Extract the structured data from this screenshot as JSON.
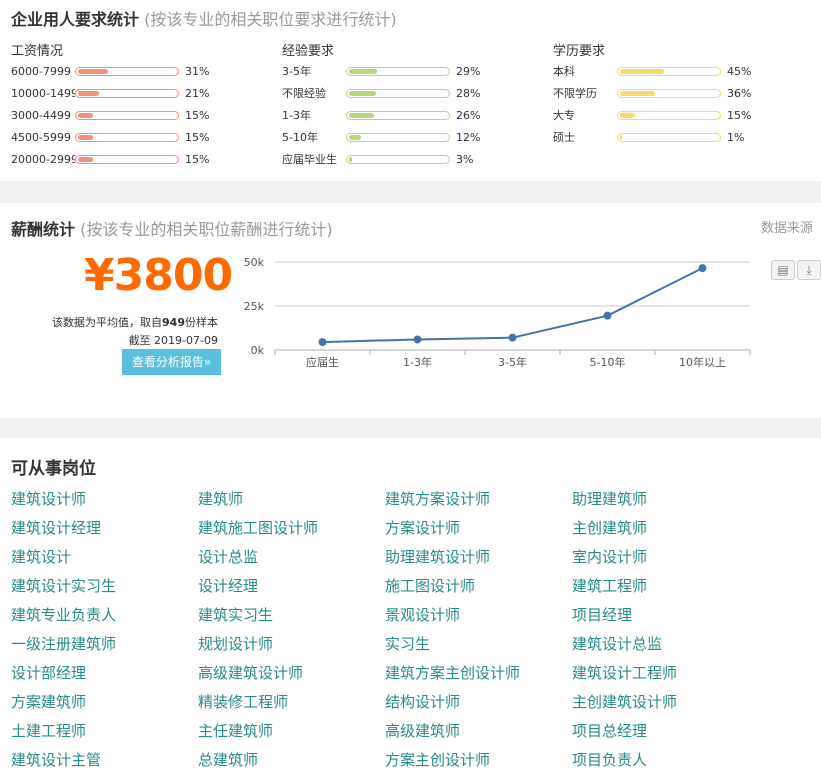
{
  "requirements": {
    "title": "企业用人要求统计",
    "subtitle": "(按该专业的相关职位要求进行统计)",
    "columns": [
      {
        "heading": "工资情况",
        "color": "#f0927a",
        "items": [
          {
            "label": "6000-7999",
            "pct": "31%",
            "value": 31
          },
          {
            "label": "10000-1499",
            "pct": "21%",
            "value": 21
          },
          {
            "label": "3000-4499",
            "pct": "15%",
            "value": 15
          },
          {
            "label": "4500-5999",
            "pct": "15%",
            "value": 15
          },
          {
            "label": "20000-2999",
            "pct": "15%",
            "value": 15
          }
        ]
      },
      {
        "heading": "经验要求",
        "color": "#b5d67a",
        "items": [
          {
            "label": "3-5年",
            "pct": "29%",
            "value": 29
          },
          {
            "label": "不限经验",
            "pct": "28%",
            "value": 28
          },
          {
            "label": "1-3年",
            "pct": "26%",
            "value": 26
          },
          {
            "label": "5-10年",
            "pct": "12%",
            "value": 12
          },
          {
            "label": "应届毕业生",
            "pct": "3%",
            "value": 3
          }
        ]
      },
      {
        "heading": "学历要求",
        "color": "#f5dc6a",
        "items": [
          {
            "label": "本科",
            "pct": "45%",
            "value": 45
          },
          {
            "label": "不限学历",
            "pct": "36%",
            "value": 36
          },
          {
            "label": "大专",
            "pct": "15%",
            "value": 15
          },
          {
            "label": "硕士",
            "pct": "1%",
            "value": 1
          }
        ]
      }
    ]
  },
  "salary": {
    "title": "薪酬统计",
    "subtitle": "(按该专业的相关职位薪酬进行统计)",
    "source_link": "数据来源",
    "amount": "¥3800",
    "note_prefix": "该数据为平均值，取自",
    "note_count": "949",
    "note_suffix": "份样本",
    "date_line": "截至 2019-07-09",
    "report_button": "查看分析报告»",
    "amount_color": "#ff6a00",
    "button_color": "#5bc0de"
  },
  "chart_data": {
    "type": "line",
    "categories": [
      "应届生",
      "1-3年",
      "3-5年",
      "5-10年",
      "10年以上"
    ],
    "values": [
      4500,
      6000,
      7000,
      19500,
      46500
    ],
    "ytick_labels": [
      "50k",
      "25k",
      "0k"
    ],
    "yticks": [
      50000,
      25000,
      0
    ],
    "ylim": [
      0,
      50000
    ],
    "grid": true,
    "line_color": "#4572a7"
  },
  "jobs": {
    "title": "可从事岗位",
    "link_color": "#2a8a8a",
    "items": [
      "建筑设计师",
      "建筑师",
      "建筑方案设计师",
      "助理建筑师",
      "建筑设计经理",
      "建筑施工图设计师",
      "方案设计师",
      "主创建筑师",
      "建筑设计",
      "设计总监",
      "助理建筑设计师",
      "室内设计师",
      "建筑设计实习生",
      "设计经理",
      "施工图设计师",
      "建筑工程师",
      "建筑专业负责人",
      "建筑实习生",
      "景观设计师",
      "项目经理",
      "一级注册建筑师",
      "规划设计师",
      "实习生",
      "建筑设计总监",
      "设计部经理",
      "高级建筑设计师",
      "建筑方案主创设计师",
      "建筑设计工程师",
      "方案建筑师",
      "精装修工程师",
      "结构设计师",
      "主创建筑设计师",
      "土建工程师",
      "主任建筑师",
      "高级建筑师",
      "项目总经理",
      "建筑设计主管",
      "总建筑师",
      "方案主创设计师",
      "项目负责人"
    ]
  }
}
